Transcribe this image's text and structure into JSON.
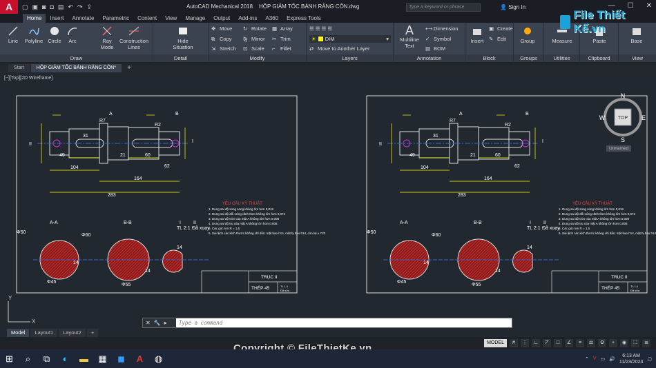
{
  "app": {
    "logo": "A",
    "title": "AutoCAD Mechanical 2018",
    "document_title": "HỘP GIẢM TỐC BÁNH RĂNG CÔN.dwg",
    "search_placeholder": "Type a keyword or phrase",
    "sign_in": "Sign In",
    "brand": "File Thiết Kế.vn"
  },
  "ribbon_tabs": [
    "Home",
    "Insert",
    "Annotate",
    "Parametric",
    "Content",
    "View",
    "Manage",
    "Output",
    "Add-ins",
    "A360",
    "Express Tools"
  ],
  "ribbon": {
    "draw": {
      "label": "Draw",
      "tools": [
        "Line",
        "Polyline",
        "Circle",
        "Arc",
        "Ray Mode",
        "Construction Lines"
      ]
    },
    "detail": {
      "label": "Detail",
      "tools": [
        "Hide Situation"
      ]
    },
    "modify": {
      "label": "Modify",
      "tools": [
        "Move",
        "Rotate",
        "Array",
        "Copy",
        "Mirror",
        "Trim",
        "Stretch",
        "Scale",
        "Fillet"
      ]
    },
    "layers": {
      "label": "Layers",
      "current_layer": "DIM",
      "move_to": "Move to Another Layer"
    },
    "annotation": {
      "label": "Annotation",
      "tools": [
        "Multiline Text",
        "Dimension",
        "Symbol",
        "BOM"
      ]
    },
    "block": {
      "label": "Block",
      "tools": [
        "Insert",
        "Create",
        "Edit"
      ]
    },
    "groups": {
      "label": "Groups",
      "tools": [
        "Group"
      ]
    },
    "utilities": {
      "label": "Utilities",
      "tools": [
        "Measure"
      ]
    },
    "clipboard": {
      "label": "Clipboard",
      "tools": [
        "Paste"
      ]
    },
    "view": {
      "label": "View",
      "tools": [
        "Base"
      ]
    }
  },
  "doc_tabs": {
    "start": "Start",
    "active": "HỘP GIẢM TỐC BÁNH RĂNG CÔN*",
    "plus": "+"
  },
  "viewport": {
    "label": "[−][Top][2D Wireframe]",
    "cube": {
      "n": "N",
      "s": "S",
      "e": "E",
      "w": "W",
      "face": "TOP"
    },
    "ucs_name": "Unnamed",
    "axis_y": "Y",
    "axis_x": "X"
  },
  "drawing": {
    "section_a": "A-A",
    "section_b": "B-B",
    "section_a_label": "A",
    "section_b_label": "B",
    "detail_i": "I",
    "detail_scale": "TL 2:1",
    "detail_ii": "II",
    "detail_rot": "Đã xoay",
    "dims": {
      "d104": "104",
      "d164": "164",
      "d283": "283",
      "d49": "49",
      "d31": "31",
      "d21": "21",
      "d60": "60",
      "d62": "62",
      "d2": "2",
      "r7": "R7",
      "r2": "R2",
      "phi45": "Φ45",
      "phi55": "Φ55",
      "phi50": "Φ50",
      "phi60": "Φ60",
      "d14a": "14",
      "d14b": "14",
      "d14c": "14"
    },
    "tol_a": "+0,018 +0,002",
    "tol_b": "-0,043",
    "tol_c": "+0,021 +0,002",
    "tech_title": "YÊU CẦU KỸ THUẬT",
    "tech_notes": [
      "1. Dung sai độ song song không lớn hơn 0,016",
      "2. Dung sai độ đối xứng rãnh then không lớn hơn 0,072",
      "3. Dung sai độ tròn của mặt A không lớn hơn 0,008",
      "4. Dung sai độ trụ của mặt A không lớn hơn 0,008",
      "5. Các góc lơn R = 1,5",
      "6. Sai lệch các kích thước không chỉ dẫn: mặt bao h14, mặt bị bao h14, còn lại ± IT/2"
    ],
    "title_block": {
      "part": "TRỤC II",
      "material": "THÉP 45",
      "scale": "TL 1:1",
      "sheet": "Đã sửa"
    }
  },
  "command": {
    "placeholder": "Type a command"
  },
  "layout_tabs": [
    "Model",
    "Layout1",
    "Layout2",
    "+"
  ],
  "statusbar": {
    "model": "MODEL"
  },
  "copyright": "Copyright © FileThietKe.vn",
  "taskbar": {
    "time": "6:13 AM",
    "date": "11/23/2024"
  }
}
